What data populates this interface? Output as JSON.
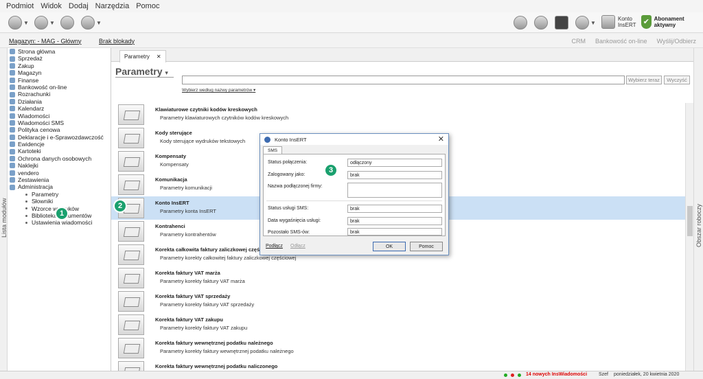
{
  "menubar": {
    "items": [
      "Podmiot",
      "Widok",
      "Dodaj",
      "Narzędzia",
      "Pomoc"
    ]
  },
  "toolbar": {
    "konto_line1": "Konto",
    "konto_line2": "InsERT",
    "abonament": "Abonament aktywny"
  },
  "bar2": {
    "magazyn": "Magazyn: - MAG - Główny",
    "brak_blokady": "Brak blokady",
    "crm": "CRM",
    "bankowosc": "Bankowość on-line",
    "wyslij": "Wyślij/Odbierz"
  },
  "side_labels": {
    "left": "Lista modułów",
    "right": "Obszar roboczy"
  },
  "sidebar": {
    "items": [
      "Strona główna",
      "Sprzedaż",
      "Zakup",
      "Magazyn",
      "Finanse",
      "Bankowość on-line",
      "Rozrachunki",
      "Działania",
      "Kalendarz",
      "Wiadomości",
      "Wiadomości SMS",
      "Polityka cenowa",
      "Deklaracje i e-Sprawozdawczość",
      "Ewidencje",
      "Kartoteki",
      "Ochrona danych osobowych",
      "Naklejki",
      "vendero",
      "Zestawienia",
      "Administracja"
    ],
    "subitems": [
      "Parametry",
      "Słowniki",
      "Wzorce wydruków",
      "Biblioteka dokumentów",
      "Ustawienia wiadomości"
    ]
  },
  "main": {
    "tab_label": "Parametry",
    "tab_close": "✕",
    "page_title": "Parametry",
    "search_btn": "Wybierz teraz",
    "clear_btn": "Wyczyść",
    "filter_link": "Wybierz według nazwy parametrów"
  },
  "rows": [
    {
      "title": "Klawiaturowe czytniki kodów kreskowych",
      "desc": "Parametry klawiaturowych czytników kodów kreskowych"
    },
    {
      "title": "Kody sterujące",
      "desc": "Kody sterujące wydruków tekstowych"
    },
    {
      "title": "Kompensaty",
      "desc": "Kompensaty"
    },
    {
      "title": "Komunikacja",
      "desc": "Parametry komunikacji"
    },
    {
      "title": "Konto InsERT",
      "desc": "Parametry konta InsERT"
    },
    {
      "title": "Kontrahenci",
      "desc": "Parametry kontrahentów"
    },
    {
      "title": "Korekta całkowita faktury zaliczkowej częściowej",
      "desc": "Parametry korekty całkowitej faktury zaliczkowej częściowej"
    },
    {
      "title": "Korekta faktury VAT marża",
      "desc": "Parametry korekty faktury VAT marża"
    },
    {
      "title": "Korekta faktury VAT sprzedaży",
      "desc": "Parametry korekty faktury VAT sprzedaży"
    },
    {
      "title": "Korekta faktury VAT zakupu",
      "desc": "Parametry korekty faktury VAT zakupu"
    },
    {
      "title": "Korekta faktury wewnętrznej podatku należnego",
      "desc": "Parametry korekty faktury wewnętrznej podatku należnego"
    },
    {
      "title": "Korekta faktury wewnętrznej podatku naliczonego",
      "desc": ""
    }
  ],
  "dialog": {
    "title": "Konto InsERT",
    "close": "✕",
    "tab": "SMS",
    "status_label": "Status połączenia:",
    "status_value": "odłączony",
    "logged_label": "Zalogowany jako:",
    "logged_value": "brak",
    "firm_label": "Nazwa podłączonej firmy:",
    "firm_value": "",
    "sms_status_label": "Status usługi SMS:",
    "sms_status_value": "brak",
    "expiry_label": "Data wygaśnięcia usługi:",
    "expiry_value": "brak",
    "remaining_label": "Pozostało SMS-ów:",
    "remaining_value": "brak",
    "connect": "Podłącz",
    "disconnect": "Odłącz",
    "ok": "OK",
    "help": "Pomoc"
  },
  "badges": [
    "1",
    "2",
    "3"
  ],
  "statusbar": {
    "news": "14 nowych InsWiadomości",
    "user": "Szef",
    "date": "poniedziałek, 20 kwietnia 2020"
  },
  "colors": {
    "badge": "#1aa06e",
    "selected_row": "#cbe0f5",
    "news": "#dd0000"
  }
}
